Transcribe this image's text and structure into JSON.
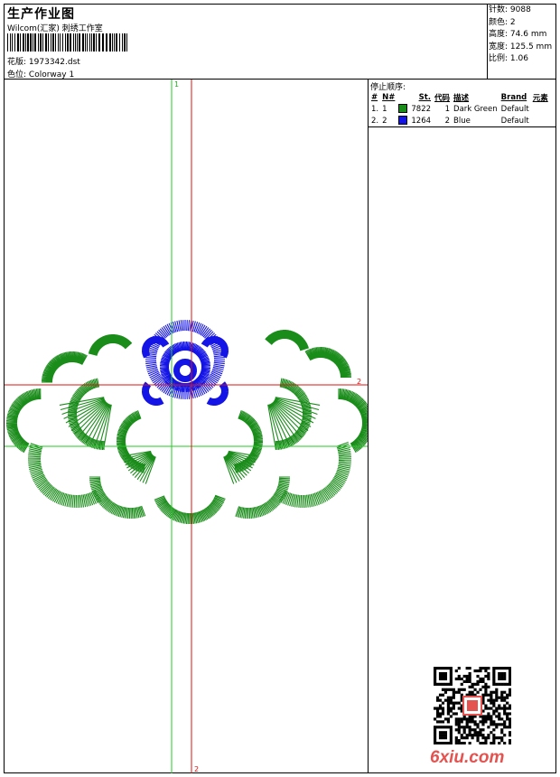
{
  "header": {
    "title": "生产作业图",
    "studio": "Wilcom(汇家) 刺绣工作室",
    "pattern_label": "花版:",
    "pattern_file": "1973342.dst",
    "colorway_label": "色位:",
    "colorway": "Colorway 1"
  },
  "stats": [
    {
      "label": "针数:",
      "value": "9088"
    },
    {
      "label": "颜色:",
      "value": "2"
    },
    {
      "label": "高度:",
      "value": "74.6 mm"
    },
    {
      "label": "宽度:",
      "value": "125.5 mm"
    },
    {
      "label": "比例:",
      "value": "1.06"
    }
  ],
  "color_panel": {
    "title": "停止顺序:",
    "headers": [
      "#",
      "N#",
      "St.",
      "代码",
      "描述",
      "Brand",
      "元素"
    ],
    "rows": [
      {
        "idx": "1.",
        "n": "1",
        "color": "#1a8c1a",
        "stitches": "7822",
        "code": "1",
        "desc": "Dark Green",
        "brand": "Default"
      },
      {
        "idx": "2.",
        "n": "2",
        "color": "#1414e6",
        "stitches": "1264",
        "code": "2",
        "desc": "Blue",
        "brand": "Default"
      }
    ]
  },
  "axes": {
    "green_label": "1",
    "red_label_right": "2",
    "red_label_bottom": "2"
  },
  "colors": {
    "green_thread": "#1a8c1a",
    "blue_thread": "#1414e6",
    "green_axis": "#22cc22",
    "red_axis": "#e01010",
    "logo": "#e4534f"
  },
  "watermark": {
    "site": "6xiu.com"
  }
}
